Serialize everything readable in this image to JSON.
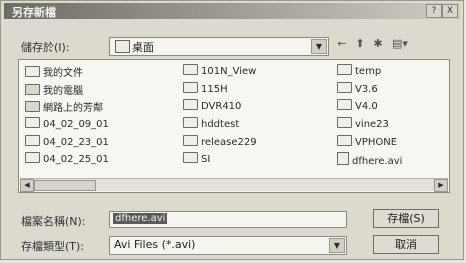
{
  "dialog": {
    "title": "另存新檔",
    "help_label": "?",
    "close_label": "X"
  },
  "save_in": {
    "label": "儲存於(I):",
    "value": "桌面"
  },
  "toolbar": {
    "back_icon": "←",
    "up_icon": "⬆",
    "new_folder_icon": "✱",
    "view_icon": "▤▾"
  },
  "files": {
    "col1": [
      {
        "name": "我的文件",
        "icon": "folder"
      },
      {
        "name": "我的電腦",
        "icon": "computer"
      },
      {
        "name": "網路上的芳鄰",
        "icon": "network"
      },
      {
        "name": "04_02_09_01",
        "icon": "folder"
      },
      {
        "name": "04_02_23_01",
        "icon": "folder"
      },
      {
        "name": "04_02_25_01",
        "icon": "folder"
      }
    ],
    "col2": [
      {
        "name": "101N_View",
        "icon": "folder"
      },
      {
        "name": "115H",
        "icon": "folder"
      },
      {
        "name": "DVR410",
        "icon": "folder"
      },
      {
        "name": "hddtest",
        "icon": "folder"
      },
      {
        "name": "release229",
        "icon": "folder"
      },
      {
        "name": "SI",
        "icon": "folder"
      }
    ],
    "col3": [
      {
        "name": "temp",
        "icon": "folder"
      },
      {
        "name": "V3.6",
        "icon": "folder"
      },
      {
        "name": "V4.0",
        "icon": "folder"
      },
      {
        "name": "vine23",
        "icon": "folder"
      },
      {
        "name": "VPHONE",
        "icon": "folder"
      },
      {
        "name": "dfhere.avi",
        "icon": "file"
      }
    ]
  },
  "filename": {
    "label": "檔案名稱(N):",
    "value": "dfhere.avi"
  },
  "filetype": {
    "label": "存檔類型(T):",
    "value": "Avi Files (*.avi)"
  },
  "buttons": {
    "save": "存檔(S)",
    "cancel": "取消"
  }
}
